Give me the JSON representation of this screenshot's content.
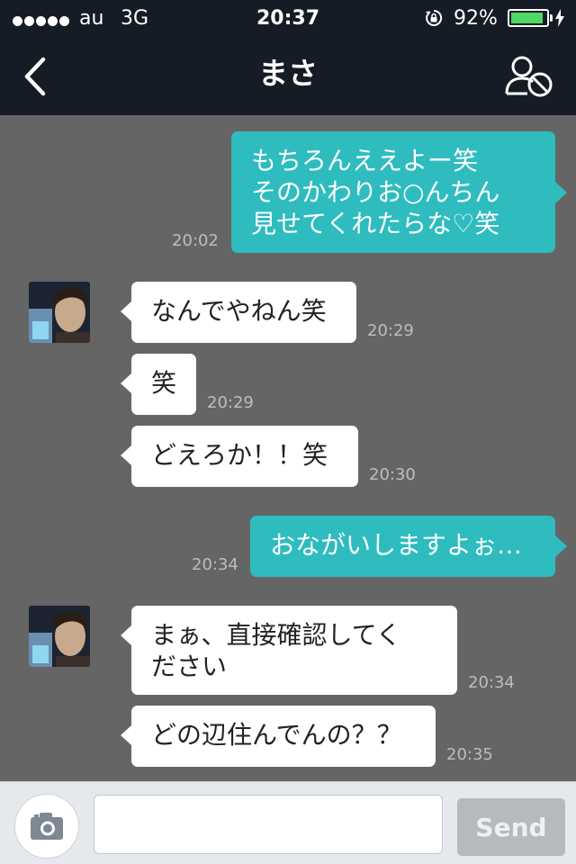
{
  "status_bar": {
    "carrier": "au",
    "network": "3G",
    "time": "20:37",
    "battery_percent": "92%",
    "battery_level": 0.92,
    "icons": [
      "signal-dots-icon",
      "rotation-lock-icon",
      "battery-icon",
      "charging-bolt-icon"
    ]
  },
  "header": {
    "title": "まさ",
    "back_icon": "chevron-left-icon",
    "block_icon": "block-user-icon"
  },
  "colors": {
    "outgoing_bubble": "#2ebcbf",
    "incoming_bubble": "#ffffff",
    "chat_background": "#656565",
    "header_background": "#151c26"
  },
  "messages": [
    {
      "direction": "out",
      "text": "もちろんええよー笑\nそのかわりお○んちん\n見せてくれたらな♡笑",
      "time": "20:02"
    },
    {
      "direction": "in",
      "text": "なんでやねん笑",
      "time": "20:29"
    },
    {
      "direction": "in",
      "text": "笑",
      "time": "20:29"
    },
    {
      "direction": "in",
      "text": "どえろか！！笑",
      "time": "20:30"
    },
    {
      "direction": "out",
      "text": "おながいしますよぉ…",
      "time": "20:34"
    },
    {
      "direction": "in",
      "text": "まぁ、直接確認してく\nださい",
      "time": "20:34"
    },
    {
      "direction": "in",
      "text": "どの辺住んでんの？？",
      "time": "20:35"
    }
  ],
  "input_bar": {
    "camera_icon": "camera-icon",
    "placeholder": "",
    "value": "",
    "send_label": "Send"
  }
}
